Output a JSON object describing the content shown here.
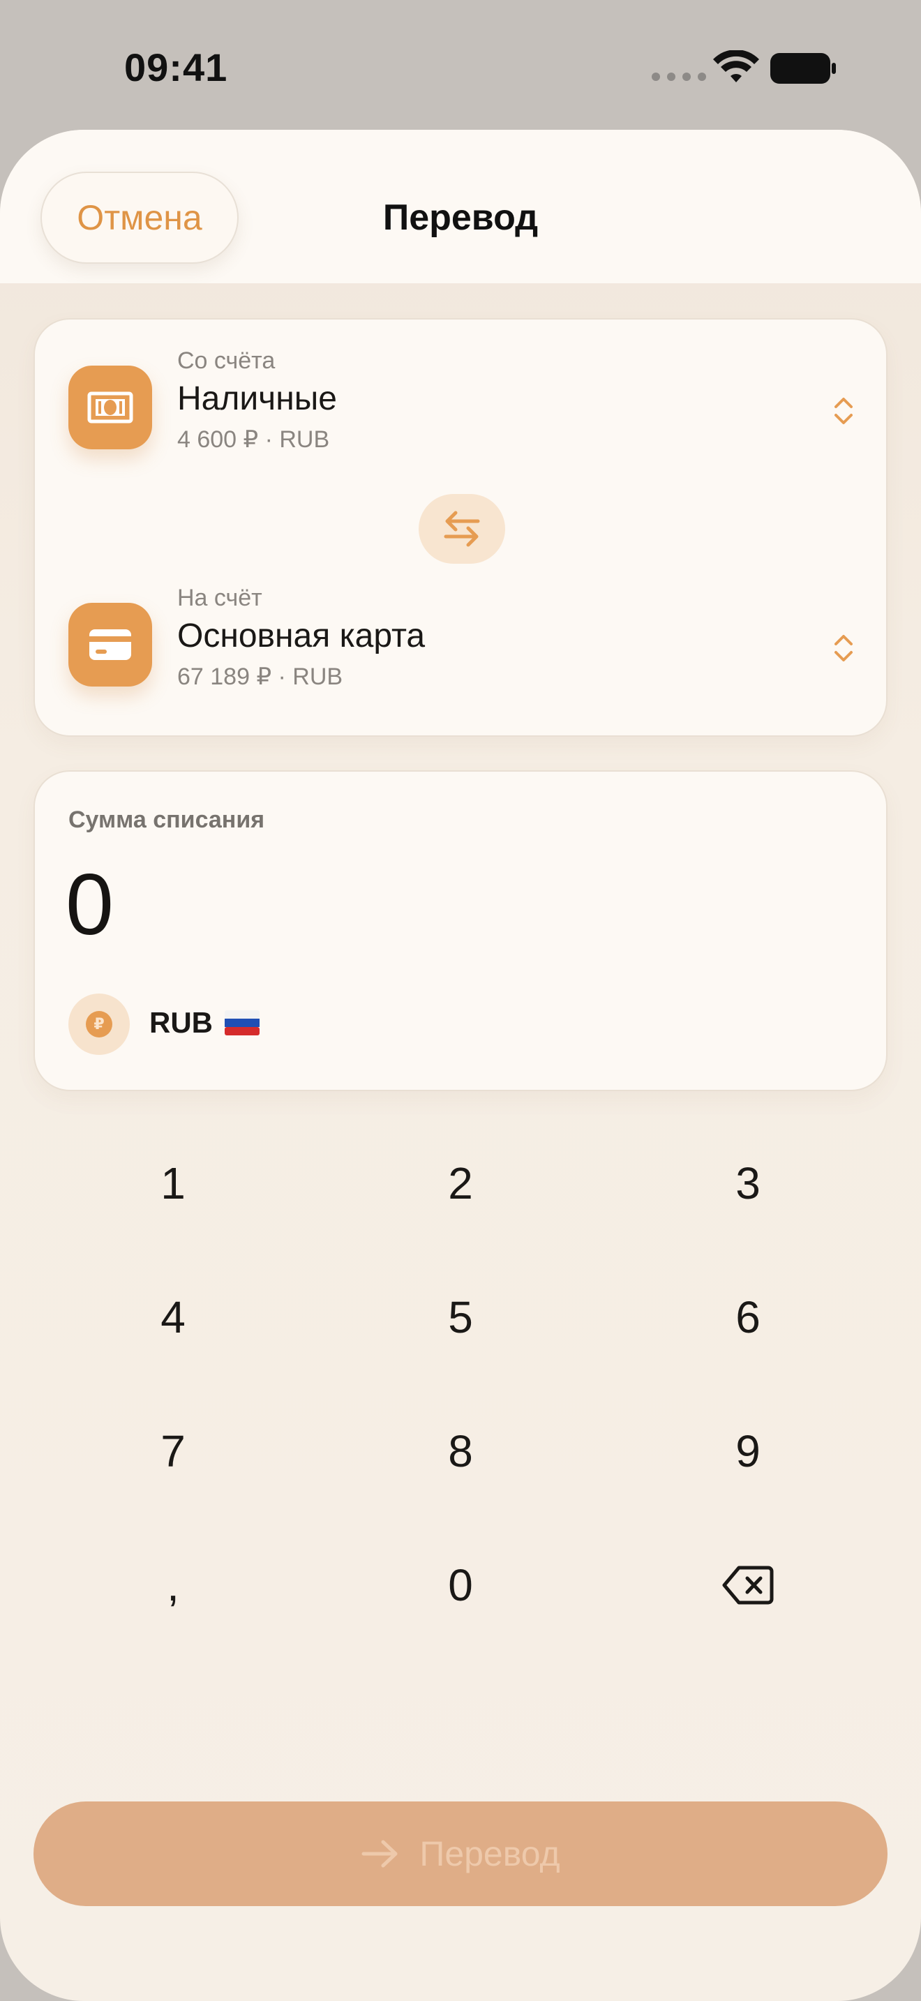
{
  "status_bar": {
    "time": "09:41"
  },
  "header": {
    "cancel_label": "Отмена",
    "title": "Перевод"
  },
  "accounts": {
    "from": {
      "caption": "Со счёта",
      "name": "Наличные",
      "balance": "4 600 ₽ · RUB",
      "icon": "cash-icon"
    },
    "to": {
      "caption": "На счёт",
      "name": "Основная карта",
      "balance": "67 189 ₽ · RUB",
      "icon": "credit-card-icon"
    }
  },
  "amount": {
    "label": "Сумма списания",
    "value": "0",
    "currency_symbol": "₽",
    "currency_code": "RUB",
    "flag": "russia-flag-icon"
  },
  "keypad": {
    "keys": [
      "1",
      "2",
      "3",
      "4",
      "5",
      "6",
      "7",
      "8",
      "9",
      ",",
      "0"
    ],
    "backspace_icon": "backspace-icon"
  },
  "submit": {
    "label": "Перевод",
    "icon": "arrow-right-icon"
  },
  "colors": {
    "accent": "#e69c52",
    "cancel_text": "#df9446",
    "submit_bg": "#dfad87",
    "background": "#f5ede3"
  }
}
